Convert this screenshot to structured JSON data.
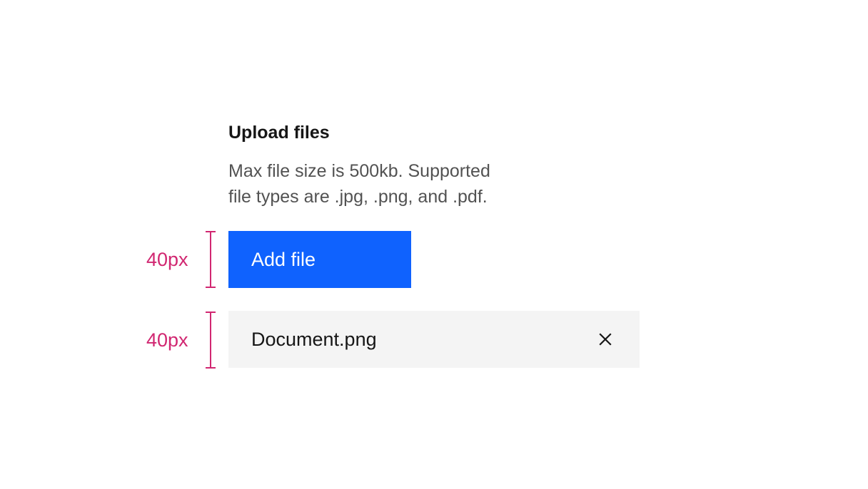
{
  "uploader": {
    "title": "Upload files",
    "description_line1": "Max file size is 500kb. Supported",
    "description_line2": "file types are .jpg, .png, and .pdf.",
    "add_button_label": "Add file",
    "file": {
      "name": "Document.png",
      "remove_icon": "close-icon"
    }
  },
  "annotations": {
    "button_height_label": "40px",
    "file_item_height_label": "40px"
  },
  "colors": {
    "primary": "#0f62fe",
    "file_item_background": "#f4f4f4",
    "annotation": "#d12771",
    "heading_text": "#161616",
    "helper_text": "#525252"
  }
}
